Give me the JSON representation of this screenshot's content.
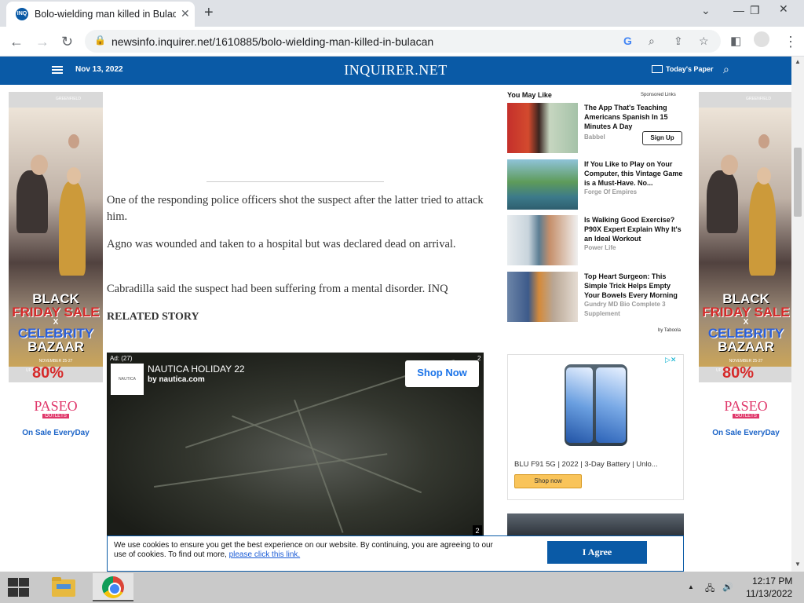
{
  "browser": {
    "tab_title": "Bolo-wielding man killed in Bulacan",
    "tab_favicon": "INQ",
    "url": "newsinfo.inquirer.net/1610885/bolo-wielding-man-killed-in-bulacan"
  },
  "site": {
    "date": "Nov 13, 2022",
    "logo": "INQUIRER.NET",
    "todays_paper": "Today's Paper",
    "brand_color": "#0a5aa6"
  },
  "article": {
    "paragraphs": [
      "One of the responding police officers shot the suspect after the latter tried to attack him.",
      "Agno was wounded and taken to a hospital but was declared dead on arrival.",
      "Cabradilla said the suspect had been suffering from a mental disorder. INQ"
    ],
    "related_story": "RELATED STORY"
  },
  "video_ad": {
    "ad_tag": "Ad: (27)",
    "logo_text": "NAUTICA",
    "title": "NAUTICA HOLIDAY 22",
    "subtitle": "by nautica.com",
    "cta": "Shop Now",
    "count_top": "2",
    "count_bottom": "2"
  },
  "side_ad": {
    "brand": "GREENFIELD",
    "line1": "BLACK",
    "line2": "FRIDAY SALE",
    "line3": "X",
    "line4": "CELEBRITY",
    "line5": "BAZAAR",
    "dates": "NOVEMBER 25-27",
    "upto": "UP TO",
    "percent": "80%",
    "paseo": "PASEO",
    "outlets": "OUTLETS",
    "sale": "On Sale EveryDay"
  },
  "you_may_like": {
    "heading": "You May Like",
    "sponsored": "Sponsored Links",
    "items": [
      {
        "title": "The App That's Teaching Americans Spanish In 15 Minutes A Day",
        "source": "Babbel",
        "cta": "Sign Up"
      },
      {
        "title": "If You Like to Play on Your Computer, this Vintage Game is a Must-Have. No...",
        "source": "Forge Of Empires"
      },
      {
        "title": "Is Walking Good Exercise? P90X Expert Explain Why It's an Ideal Workout",
        "source": "Power Life"
      },
      {
        "title": "Top Heart Surgeon: This Simple Trick Helps Empty Your Bowels Every Morning",
        "source": "Gundry MD Bio Complete 3 Supplement"
      }
    ],
    "by": "by Taboola"
  },
  "phone_ad": {
    "title": "BLU F91 5G | 2022 | 3-Day Battery | Unlo...",
    "cta": "Shop now"
  },
  "cookie": {
    "text": "We use cookies to ensure you get the best experience on our website. By continuing, you are agreeing to our use of cookies. To find out more,",
    "link": "please click this link.",
    "button": "I Agree"
  },
  "taskbar": {
    "time": "12:17 PM",
    "date": "11/13/2022"
  }
}
